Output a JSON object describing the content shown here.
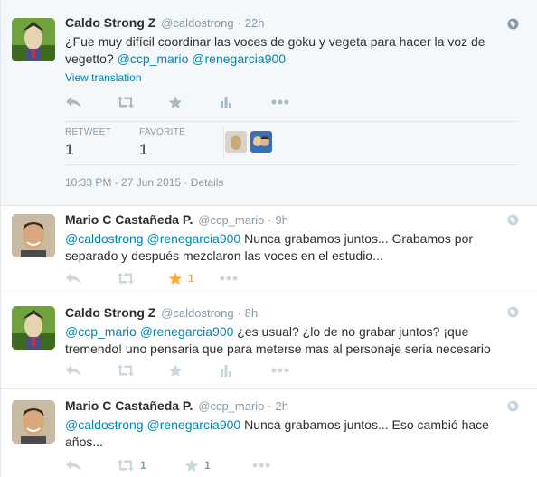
{
  "tweets": [
    {
      "fullname": "Caldo Strong Z",
      "handle": "@caldostrong",
      "dot": "·",
      "time": "22h",
      "text_parts": [
        "¿Fue muy difícil coordinar las voces de goku y vegeta para hacer la voz de vegetto? ",
        "@ccp_mario",
        " ",
        "@renegarcia900"
      ],
      "view_translation": "View translation",
      "stats": {
        "retweet_label": "RETWEET",
        "retweet_count": "1",
        "favorite_label": "FAVORITE",
        "favorite_count": "1"
      },
      "timestamp": "10:33 PM - 27 Jun 2015",
      "meta_dot": "·",
      "details": "Details"
    },
    {
      "fullname": "Mario C Castañeda P.",
      "handle": "@ccp_mario",
      "dot": "·",
      "time": "9h",
      "text_parts": [
        "@caldostrong",
        " ",
        "@renegarcia900",
        " Nunca grabamos juntos... Grabamos por separado y después mezclaron las voces en el estudio..."
      ],
      "favorite_count": "1"
    },
    {
      "fullname": "Caldo Strong Z",
      "handle": "@caldostrong",
      "dot": "·",
      "time": "8h",
      "text_parts": [
        "@ccp_mario",
        " ",
        "@renegarcia900",
        " ¿es usual? ¿lo de no grabar juntos? ¡que tremendo! uno pensaria que para meterse mas al personaje seria necesario"
      ]
    },
    {
      "fullname": "Mario C Castañeda P.",
      "handle": "@ccp_mario",
      "dot": "·",
      "time": "2h",
      "text_parts": [
        "@caldostrong",
        " ",
        "@renegarcia900",
        " Nunca grabamos juntos... Eso cambió hace años..."
      ],
      "retweet_count": "1",
      "favorite_count": "1"
    }
  ],
  "colors": {
    "link": "#0084b4",
    "muted": "#8899a6",
    "favorite_active": "#ffac33"
  },
  "icons": [
    "reply-icon",
    "retweet-icon",
    "favorite-icon",
    "analytics-icon",
    "more-icon",
    "globe-icon"
  ]
}
